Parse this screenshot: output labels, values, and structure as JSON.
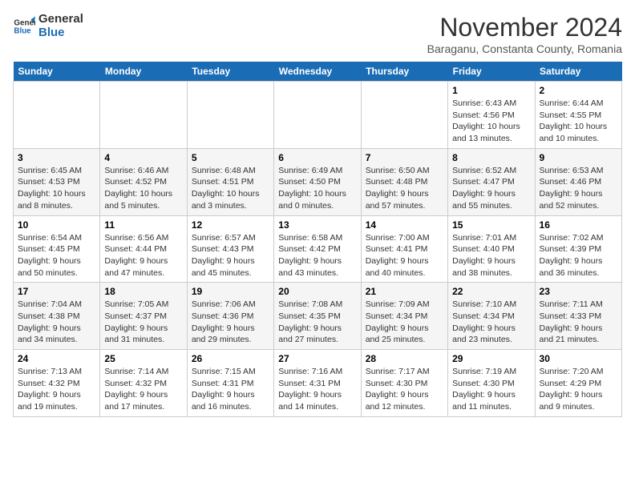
{
  "logo": {
    "line1": "General",
    "line2": "Blue"
  },
  "title": "November 2024",
  "location": "Baraganu, Constanta County, Romania",
  "headers": [
    "Sunday",
    "Monday",
    "Tuesday",
    "Wednesday",
    "Thursday",
    "Friday",
    "Saturday"
  ],
  "weeks": [
    [
      {
        "day": "",
        "info": ""
      },
      {
        "day": "",
        "info": ""
      },
      {
        "day": "",
        "info": ""
      },
      {
        "day": "",
        "info": ""
      },
      {
        "day": "",
        "info": ""
      },
      {
        "day": "1",
        "info": "Sunrise: 6:43 AM\nSunset: 4:56 PM\nDaylight: 10 hours and 13 minutes."
      },
      {
        "day": "2",
        "info": "Sunrise: 6:44 AM\nSunset: 4:55 PM\nDaylight: 10 hours and 10 minutes."
      }
    ],
    [
      {
        "day": "3",
        "info": "Sunrise: 6:45 AM\nSunset: 4:53 PM\nDaylight: 10 hours and 8 minutes."
      },
      {
        "day": "4",
        "info": "Sunrise: 6:46 AM\nSunset: 4:52 PM\nDaylight: 10 hours and 5 minutes."
      },
      {
        "day": "5",
        "info": "Sunrise: 6:48 AM\nSunset: 4:51 PM\nDaylight: 10 hours and 3 minutes."
      },
      {
        "day": "6",
        "info": "Sunrise: 6:49 AM\nSunset: 4:50 PM\nDaylight: 10 hours and 0 minutes."
      },
      {
        "day": "7",
        "info": "Sunrise: 6:50 AM\nSunset: 4:48 PM\nDaylight: 9 hours and 57 minutes."
      },
      {
        "day": "8",
        "info": "Sunrise: 6:52 AM\nSunset: 4:47 PM\nDaylight: 9 hours and 55 minutes."
      },
      {
        "day": "9",
        "info": "Sunrise: 6:53 AM\nSunset: 4:46 PM\nDaylight: 9 hours and 52 minutes."
      }
    ],
    [
      {
        "day": "10",
        "info": "Sunrise: 6:54 AM\nSunset: 4:45 PM\nDaylight: 9 hours and 50 minutes."
      },
      {
        "day": "11",
        "info": "Sunrise: 6:56 AM\nSunset: 4:44 PM\nDaylight: 9 hours and 47 minutes."
      },
      {
        "day": "12",
        "info": "Sunrise: 6:57 AM\nSunset: 4:43 PM\nDaylight: 9 hours and 45 minutes."
      },
      {
        "day": "13",
        "info": "Sunrise: 6:58 AM\nSunset: 4:42 PM\nDaylight: 9 hours and 43 minutes."
      },
      {
        "day": "14",
        "info": "Sunrise: 7:00 AM\nSunset: 4:41 PM\nDaylight: 9 hours and 40 minutes."
      },
      {
        "day": "15",
        "info": "Sunrise: 7:01 AM\nSunset: 4:40 PM\nDaylight: 9 hours and 38 minutes."
      },
      {
        "day": "16",
        "info": "Sunrise: 7:02 AM\nSunset: 4:39 PM\nDaylight: 9 hours and 36 minutes."
      }
    ],
    [
      {
        "day": "17",
        "info": "Sunrise: 7:04 AM\nSunset: 4:38 PM\nDaylight: 9 hours and 34 minutes."
      },
      {
        "day": "18",
        "info": "Sunrise: 7:05 AM\nSunset: 4:37 PM\nDaylight: 9 hours and 31 minutes."
      },
      {
        "day": "19",
        "info": "Sunrise: 7:06 AM\nSunset: 4:36 PM\nDaylight: 9 hours and 29 minutes."
      },
      {
        "day": "20",
        "info": "Sunrise: 7:08 AM\nSunset: 4:35 PM\nDaylight: 9 hours and 27 minutes."
      },
      {
        "day": "21",
        "info": "Sunrise: 7:09 AM\nSunset: 4:34 PM\nDaylight: 9 hours and 25 minutes."
      },
      {
        "day": "22",
        "info": "Sunrise: 7:10 AM\nSunset: 4:34 PM\nDaylight: 9 hours and 23 minutes."
      },
      {
        "day": "23",
        "info": "Sunrise: 7:11 AM\nSunset: 4:33 PM\nDaylight: 9 hours and 21 minutes."
      }
    ],
    [
      {
        "day": "24",
        "info": "Sunrise: 7:13 AM\nSunset: 4:32 PM\nDaylight: 9 hours and 19 minutes."
      },
      {
        "day": "25",
        "info": "Sunrise: 7:14 AM\nSunset: 4:32 PM\nDaylight: 9 hours and 17 minutes."
      },
      {
        "day": "26",
        "info": "Sunrise: 7:15 AM\nSunset: 4:31 PM\nDaylight: 9 hours and 16 minutes."
      },
      {
        "day": "27",
        "info": "Sunrise: 7:16 AM\nSunset: 4:31 PM\nDaylight: 9 hours and 14 minutes."
      },
      {
        "day": "28",
        "info": "Sunrise: 7:17 AM\nSunset: 4:30 PM\nDaylight: 9 hours and 12 minutes."
      },
      {
        "day": "29",
        "info": "Sunrise: 7:19 AM\nSunset: 4:30 PM\nDaylight: 9 hours and 11 minutes."
      },
      {
        "day": "30",
        "info": "Sunrise: 7:20 AM\nSunset: 4:29 PM\nDaylight: 9 hours and 9 minutes."
      }
    ]
  ]
}
